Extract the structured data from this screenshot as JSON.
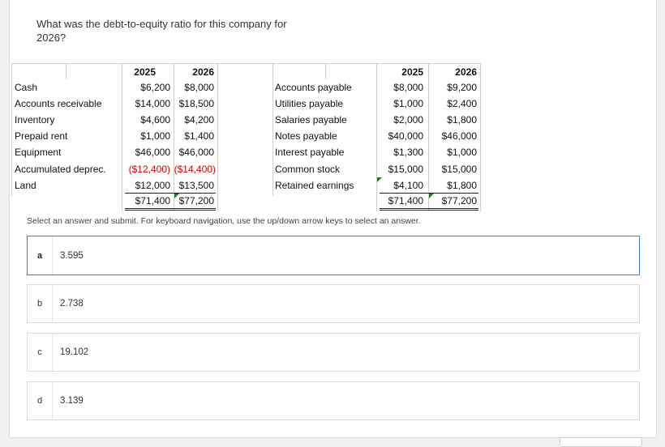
{
  "question": {
    "text": "What was the debt-to-equity ratio for this company for 2026?"
  },
  "table": {
    "years": [
      "2025",
      "2026"
    ],
    "assets": [
      {
        "label": "Cash",
        "y2025": "$6,200",
        "y2026": "$8,000"
      },
      {
        "label": "Accounts receivable",
        "y2025": "$14,000",
        "y2026": "$18,500"
      },
      {
        "label": "Inventory",
        "y2025": "$4,600",
        "y2026": "$4,200"
      },
      {
        "label": "Prepaid rent",
        "y2025": "$1,000",
        "y2026": "$1,400"
      },
      {
        "label": "Equipment",
        "y2025": "$46,000",
        "y2026": "$46,000"
      },
      {
        "label": "Accumulated deprec.",
        "y2025": "($12,400)",
        "y2026": "($14,400)"
      },
      {
        "label": "Land",
        "y2025": "$12,000",
        "y2026": "$13,500"
      }
    ],
    "asset_totals": {
      "y2025": "$71,400",
      "y2026": "$77,200"
    },
    "liabilities": [
      {
        "label": "Accounts payable",
        "y2025": "$8,000",
        "y2026": "$9,200"
      },
      {
        "label": "Utilities payable",
        "y2025": "$1,000",
        "y2026": "$2,400"
      },
      {
        "label": "Salaries payable",
        "y2025": "$2,000",
        "y2026": "$1,800"
      },
      {
        "label": "Notes payable",
        "y2025": "$40,000",
        "y2026": "$46,000"
      },
      {
        "label": "Interest payable",
        "y2025": "$1,300",
        "y2026": "$1,000"
      },
      {
        "label": "Common stock",
        "y2025": "$15,000",
        "y2026": "$15,000"
      },
      {
        "label": "Retained earnings",
        "y2025": "$4,100",
        "y2026": "$1,800"
      }
    ],
    "liability_totals": {
      "y2025": "$71,400",
      "y2026": "$77,200"
    }
  },
  "instructions": "Select an answer and submit. For keyboard navigation, use the up/down arrow keys to select an answer.",
  "options": [
    {
      "letter": "a",
      "text": "3.595",
      "selected": true
    },
    {
      "letter": "b",
      "text": "2.738",
      "selected": false
    },
    {
      "letter": "c",
      "text": "19.102",
      "selected": false
    },
    {
      "letter": "d",
      "text": "3.139",
      "selected": false
    }
  ],
  "colors": {
    "selected_border": "#3a7bd5",
    "negative": "#d00000",
    "comment_marker": "#1e7b1e"
  }
}
